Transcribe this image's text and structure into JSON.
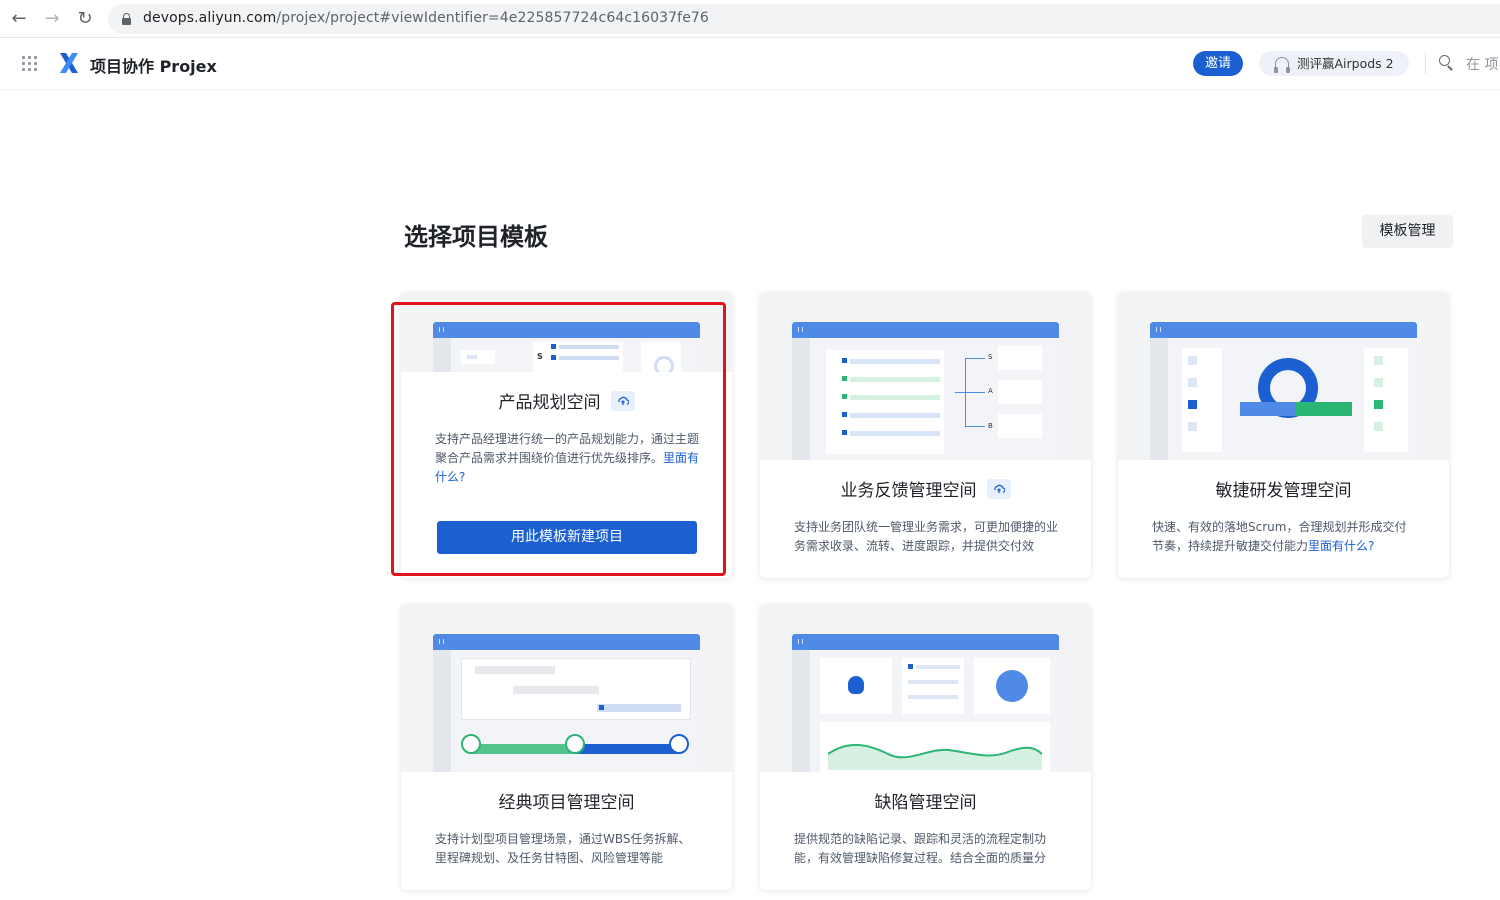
{
  "browser": {
    "back": "←",
    "forward": "→",
    "reload": "↻",
    "url_host": "devops.aliyun.com",
    "url_path": "/projex/project#viewIdentifier=4e225857724c64c16037fe76"
  },
  "header": {
    "app_name": "项目协作 Projex",
    "invite_label": "邀请",
    "user_label": "测评赢Airpods 2",
    "search_hint": "在 项"
  },
  "page": {
    "title": "选择项目模板",
    "manage_label": "模板管理"
  },
  "colors": {
    "primary": "#1b5fd0",
    "highlight": "#e1141b",
    "green": "#2bb673"
  },
  "cards": [
    {
      "title": "产品规划空间",
      "has_badge": true,
      "desc": "支持产品经理进行统一的产品规划能力，通过主题聚合产品需求并围绕价值进行优先级排序。",
      "link": "里面有什么?",
      "button": "用此模板新建项目",
      "thumb_letter": "S"
    },
    {
      "title": "业务反馈管理空间",
      "has_badge": true,
      "desc": "支持业务团队统一管理业务需求，可更加便捷的业务需求收录、流转、进度跟踪，并提供交付效",
      "thumb_labels": [
        "S",
        "A",
        "B"
      ]
    },
    {
      "title": "敏捷研发管理空间",
      "has_badge": false,
      "desc": "快速、有效的落地Scrum，合理规划并形成交付节奏，持续提升敏捷交付能力",
      "link": "里面有什么?"
    },
    {
      "title": "经典项目管理空间",
      "has_badge": false,
      "desc": "支持计划型项目管理场景，通过WBS任务拆解、里程碑规划、及任务甘特图、风险管理等能"
    },
    {
      "title": "缺陷管理空间",
      "has_badge": false,
      "desc": "提供规范的缺陷记录、跟踪和灵活的流程定制功能，有效管理缺陷修复过程。结合全面的质量分"
    }
  ]
}
